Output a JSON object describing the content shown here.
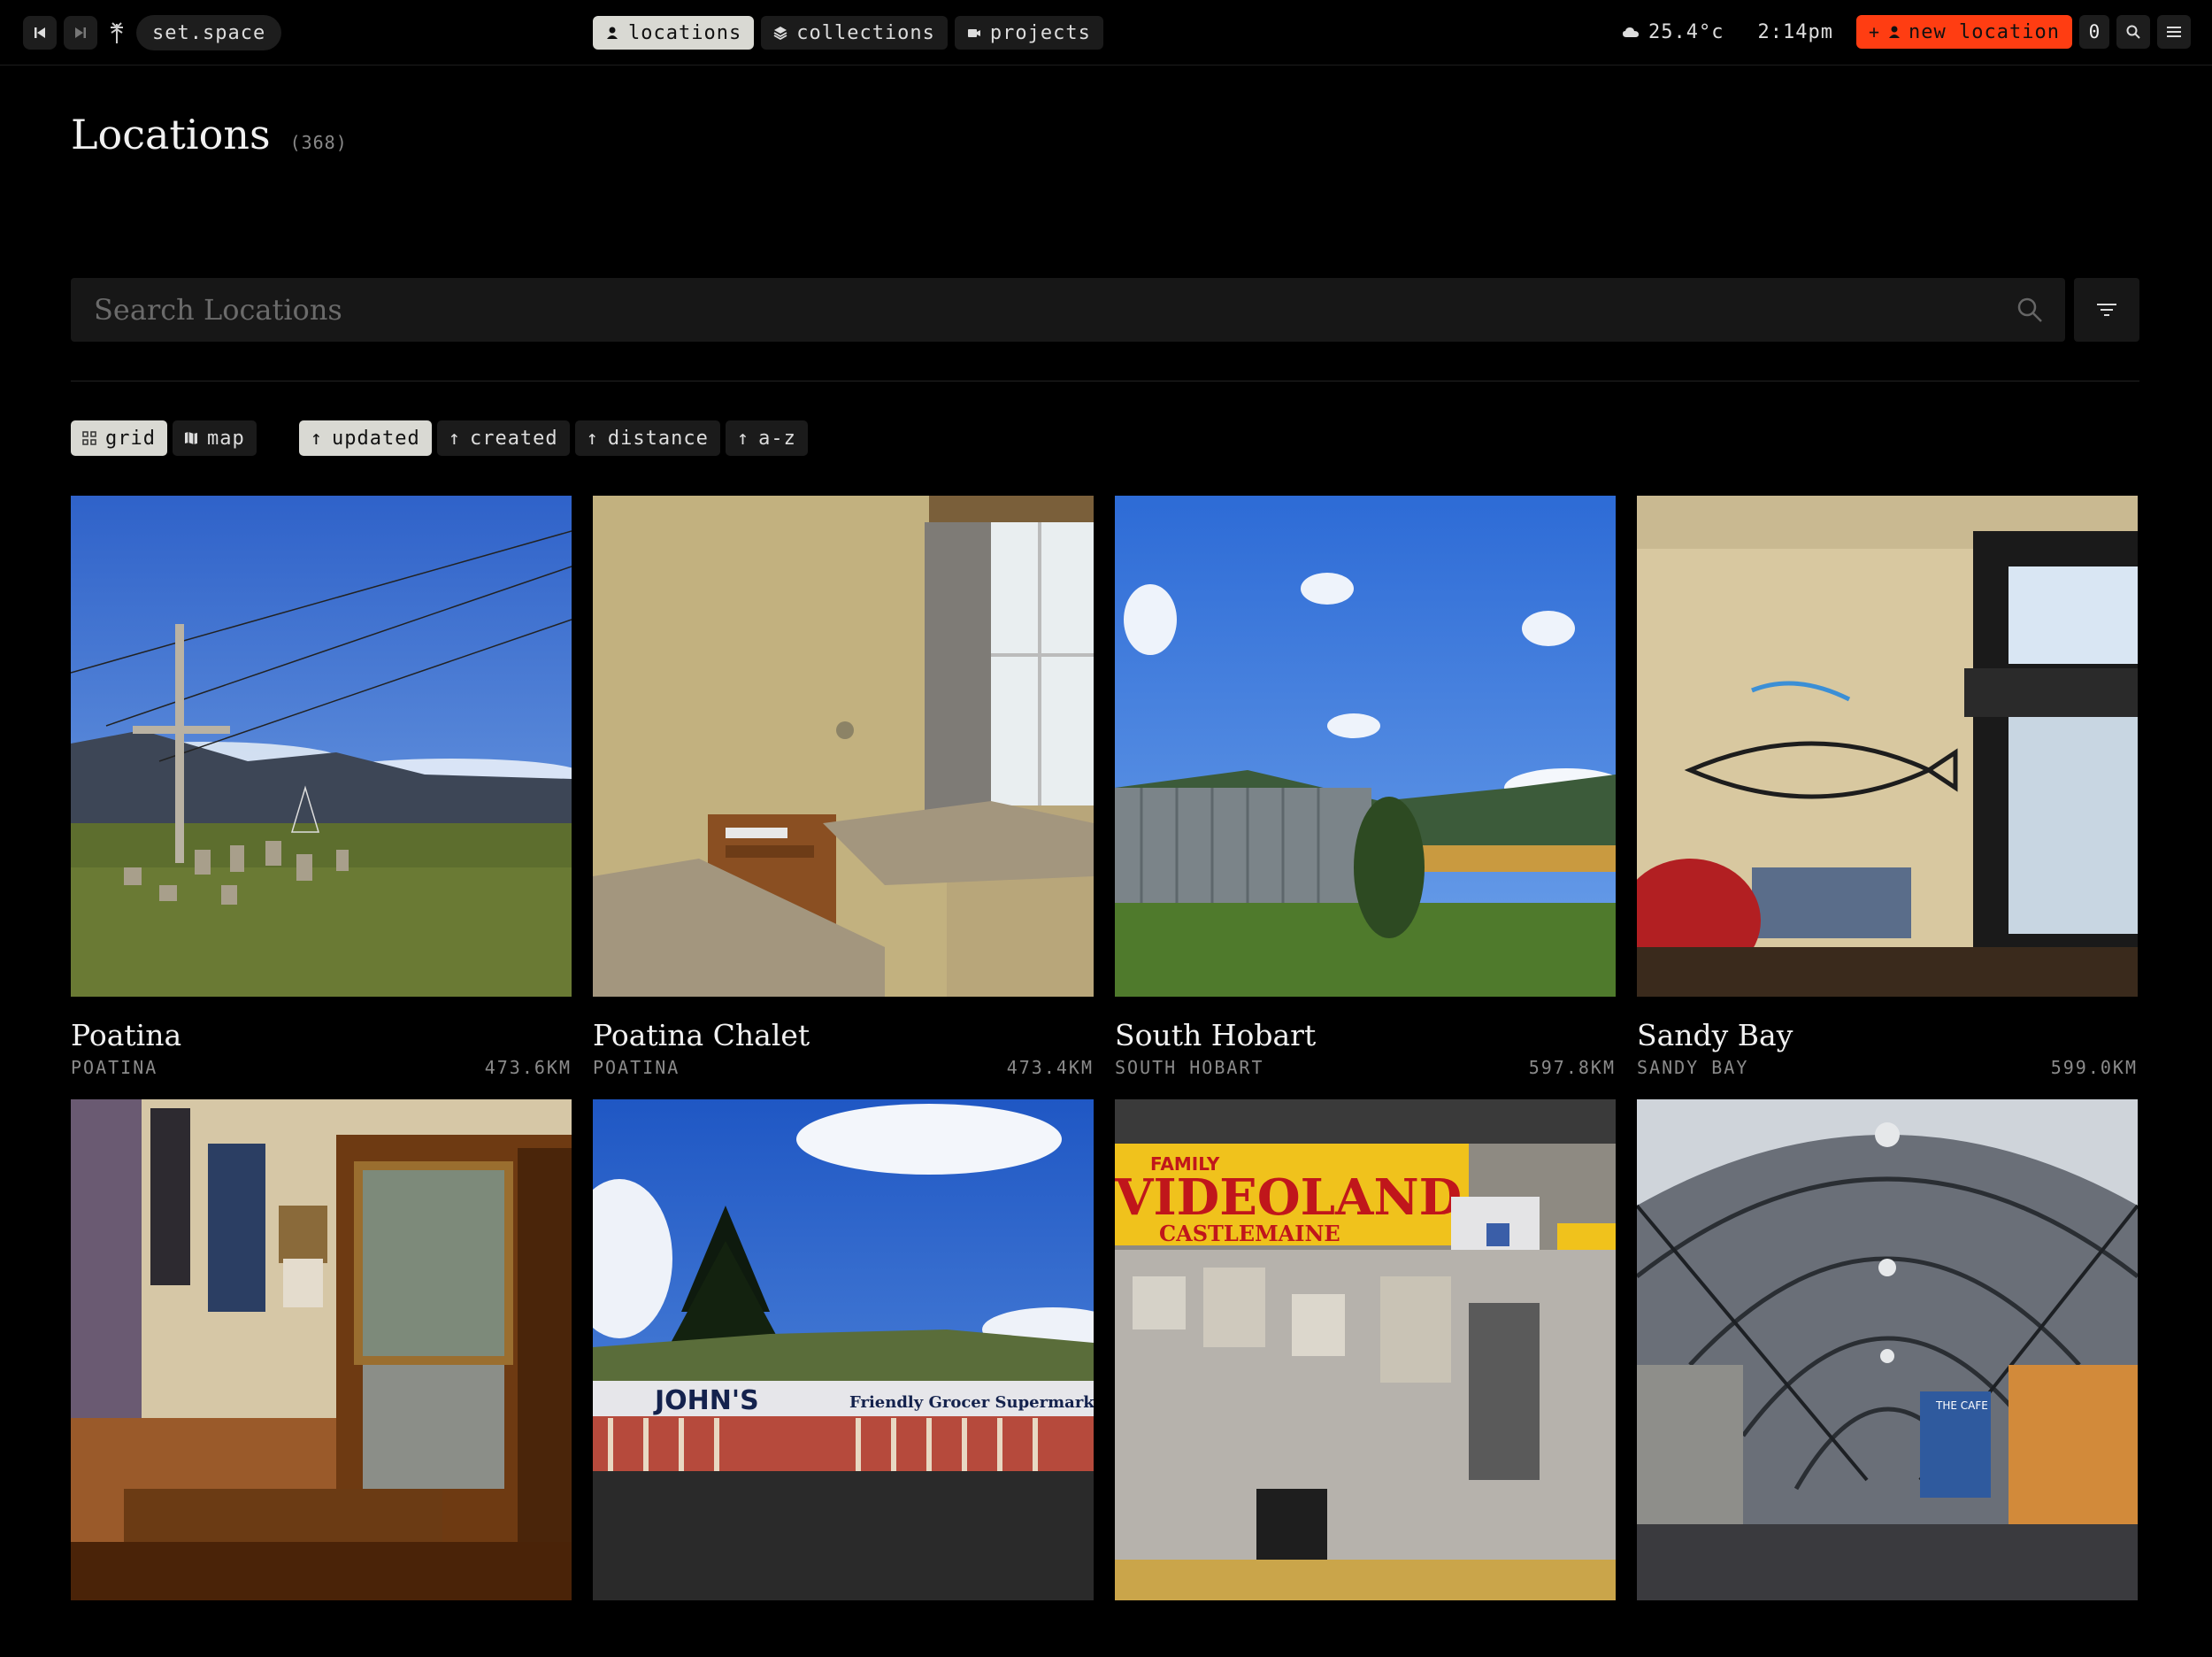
{
  "topbar": {
    "space_name": "set.space",
    "nav": [
      {
        "label": "locations",
        "icon": "pin-icon",
        "active": true
      },
      {
        "label": "collections",
        "icon": "layers-icon",
        "active": false
      },
      {
        "label": "projects",
        "icon": "camera-icon",
        "active": false
      }
    ],
    "weather": "25.4°c",
    "time": "2:14pm",
    "new_location_label": "new location",
    "notification_count": "0"
  },
  "page": {
    "title": "Locations",
    "count": "(368)"
  },
  "search": {
    "placeholder": "Search Locations"
  },
  "view_toggle": [
    {
      "label": "grid",
      "active": true
    },
    {
      "label": "map",
      "active": false
    }
  ],
  "sort": [
    {
      "label": "updated",
      "active": true
    },
    {
      "label": "created",
      "active": false
    },
    {
      "label": "distance",
      "active": false
    },
    {
      "label": "a-z",
      "active": false
    }
  ],
  "locations": [
    {
      "name": "Poatina",
      "region": "POATINA",
      "distance": "473.6KM"
    },
    {
      "name": "Poatina Chalet",
      "region": "POATINA",
      "distance": "473.4KM"
    },
    {
      "name": "South Hobart",
      "region": "SOUTH HOBART",
      "distance": "597.8KM"
    },
    {
      "name": "Sandy Bay",
      "region": "SANDY BAY",
      "distance": "599.0KM"
    },
    {
      "name": "",
      "region": "",
      "distance": ""
    },
    {
      "name": "",
      "region": "",
      "distance": ""
    },
    {
      "name": "",
      "region": "",
      "distance": ""
    },
    {
      "name": "",
      "region": "",
      "distance": ""
    }
  ],
  "photo_signs": {
    "johns_main": "JOHN'S",
    "johns_sub": "Friendly  Grocer  Supermarket",
    "videoland_small": "FAMILY",
    "videoland_main": "VIDEOLAND",
    "videoland_sub": "CASTLEMAINE",
    "cafe_sign": "THE CAFE"
  },
  "colors": {
    "accent": "#ff3d12",
    "active_pill": "#d9d9d3",
    "background": "#000000",
    "surface": "#171717"
  }
}
